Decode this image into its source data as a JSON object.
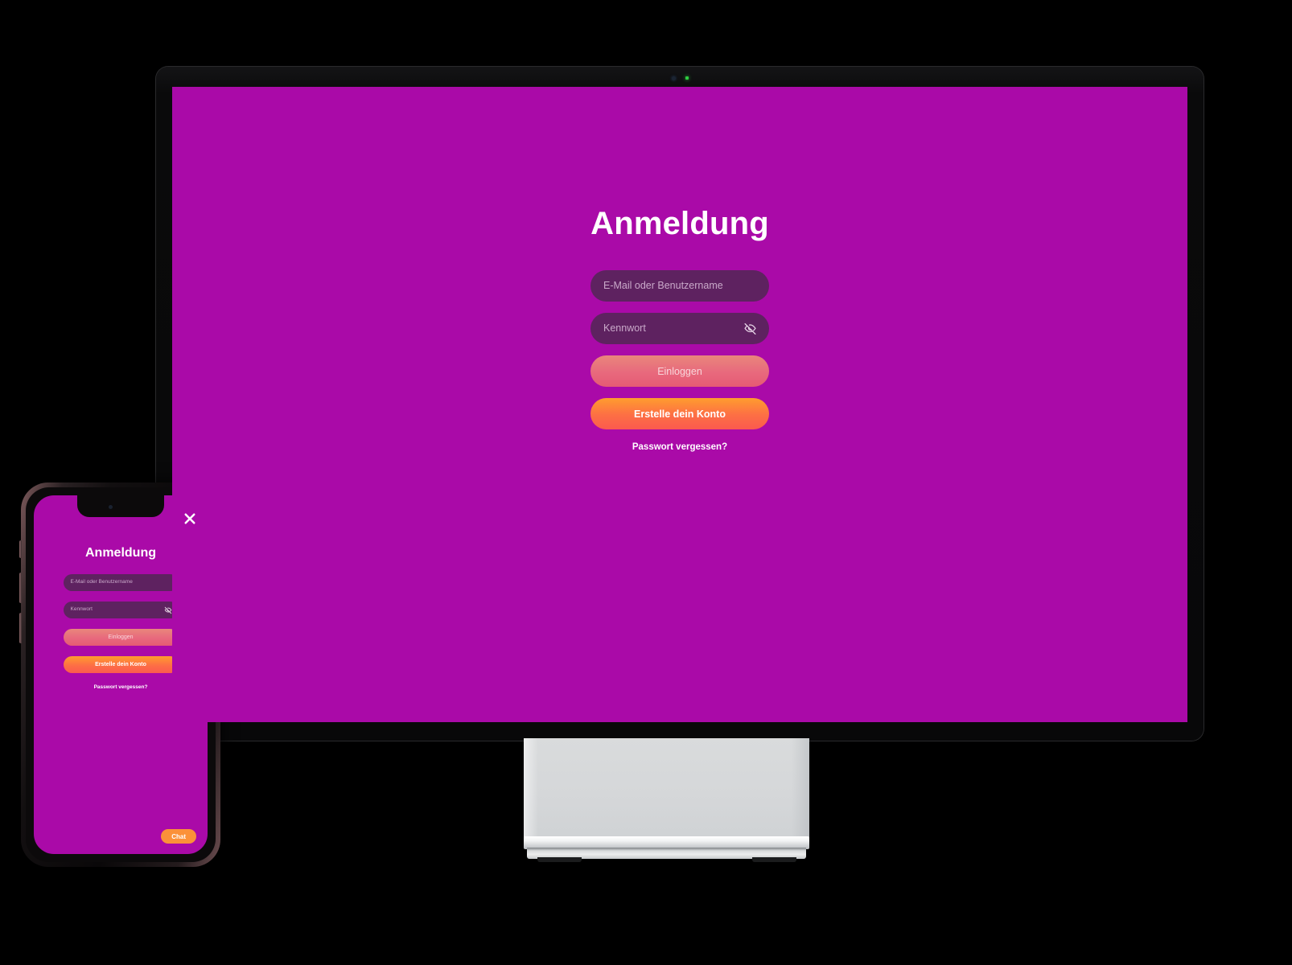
{
  "colors": {
    "screen_background": "#AA0AA8",
    "input_background": "#5E2260",
    "placeholder_text": "#C9A9C9",
    "login_gradient_top": "#E9867C",
    "login_gradient_bottom": "#E55A74",
    "signup_gradient_top": "#FF9D2E",
    "signup_gradient_bottom": "#FB5A4E",
    "chat_button": "#FB9139",
    "bezel": "#0B0B0C",
    "stand": "#D7D9DA",
    "text_white": "#FFFFFF"
  },
  "desktop": {
    "device": "desktop-monitor",
    "webcam_icon": "camera-dot-icon",
    "status_led_icon": "green-led-icon",
    "app": {
      "title": "Anmeldung",
      "username_field": {
        "placeholder": "E-Mail oder Benutzername",
        "value": ""
      },
      "password_field": {
        "placeholder": "Kennwort",
        "value": "",
        "toggle_icon": "eye-off-icon"
      },
      "login_button": "Einloggen",
      "signup_button": "Erstelle dein Konto",
      "forgot_password_link": "Passwort vergessen?"
    }
  },
  "mobile": {
    "device": "smartphone",
    "close_icon": "close-x-icon",
    "notch_camera_icon": "camera-dot-icon",
    "app": {
      "title": "Anmeldung",
      "username_field": {
        "placeholder": "E-Mail oder Benutzername",
        "value": ""
      },
      "password_field": {
        "placeholder": "Kennwort",
        "value": "",
        "toggle_icon": "eye-off-icon"
      },
      "login_button": "Einloggen",
      "signup_button": "Erstelle dein Konto",
      "forgot_password_link": "Passwort vergessen?",
      "chat_button": "Chat"
    }
  }
}
